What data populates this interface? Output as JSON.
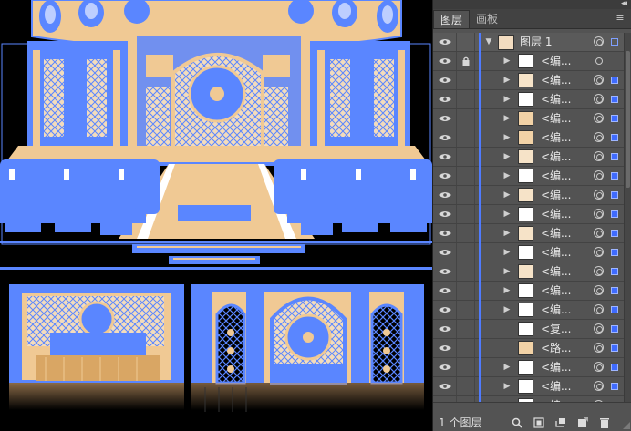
{
  "panel": {
    "collapse_glyph": "◂◂",
    "tabs": [
      {
        "label": "图层",
        "active": true
      },
      {
        "label": "画板",
        "active": false
      }
    ],
    "menu_icon": "panel-menu-icon",
    "layer": {
      "name": "图层 1",
      "expanded": true,
      "color": "#4f7bff"
    },
    "sublayers": [
      {
        "name": "<编...",
        "locked": true,
        "expandable": true,
        "target_filled": false
      },
      {
        "name": "<编...",
        "locked": false,
        "expandable": true,
        "target_filled": true
      },
      {
        "name": "<编...",
        "locked": false,
        "expandable": true,
        "target_filled": true
      },
      {
        "name": "<编...",
        "locked": false,
        "expandable": true,
        "target_filled": true
      },
      {
        "name": "<编...",
        "locked": false,
        "expandable": true,
        "target_filled": true
      },
      {
        "name": "<编...",
        "locked": false,
        "expandable": true,
        "target_filled": true
      },
      {
        "name": "<编...",
        "locked": false,
        "expandable": true,
        "target_filled": true
      },
      {
        "name": "<编...",
        "locked": false,
        "expandable": true,
        "target_filled": true
      },
      {
        "name": "<编...",
        "locked": false,
        "expandable": true,
        "target_filled": true
      },
      {
        "name": "<编...",
        "locked": false,
        "expandable": true,
        "target_filled": true
      },
      {
        "name": "<编...",
        "locked": false,
        "expandable": true,
        "target_filled": true
      },
      {
        "name": "<编...",
        "locked": false,
        "expandable": true,
        "target_filled": true
      },
      {
        "name": "<编...",
        "locked": false,
        "expandable": true,
        "target_filled": true
      },
      {
        "name": "<编...",
        "locked": false,
        "expandable": true,
        "target_filled": true
      },
      {
        "name": "<复...",
        "locked": false,
        "expandable": false,
        "target_filled": true
      },
      {
        "name": "<路...",
        "locked": false,
        "expandable": false,
        "target_filled": true
      },
      {
        "name": "<编...",
        "locked": false,
        "expandable": true,
        "target_filled": true
      },
      {
        "name": "<编...",
        "locked": false,
        "expandable": true,
        "target_filled": true
      },
      {
        "name": "<编...",
        "locked": false,
        "expandable": true,
        "target_filled": true
      }
    ],
    "footer": {
      "layer_count": "1 个图层",
      "icons": [
        "locate-object-icon",
        "make-clipping-mask-icon",
        "new-sublayer-icon",
        "new-layer-icon",
        "delete-icon"
      ]
    }
  },
  "canvas": {
    "artwork": "wedding-stage-design",
    "colors": {
      "selection": "#5a86ff",
      "fill": "#f0c994",
      "background": "#000000",
      "highlight": "#ffffff"
    }
  }
}
